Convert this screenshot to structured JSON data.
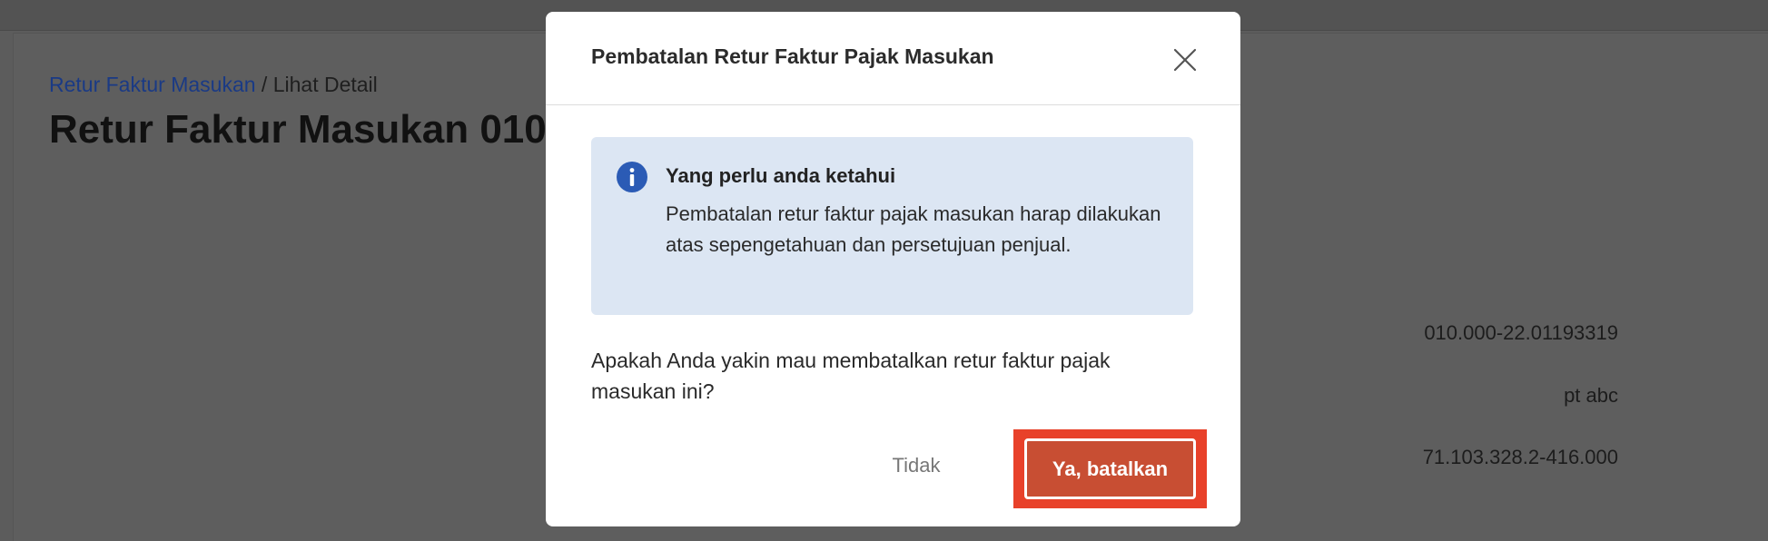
{
  "background": {
    "breadcrumb": {
      "link": "Retur Faktur Masukan",
      "separator": " / ",
      "current": "Lihat Detail"
    },
    "page_title": "Retur Faktur Masukan 010.0",
    "values": [
      "010.000-22.01193319",
      "pt abc",
      "71.103.328.2-416.000"
    ]
  },
  "modal": {
    "title": "Pembatalan Retur Faktur Pajak Masukan",
    "close_icon": "close-icon",
    "info": {
      "icon": "info-icon",
      "heading": "Yang perlu anda ketahui",
      "body": "Pembatalan retur faktur pajak masukan harap dilakukan atas sepengetahuan dan persetujuan penjual."
    },
    "question": "Apakah Anda yakin mau membatalkan retur faktur pajak masukan ini?",
    "cancel_label": "Tidak",
    "confirm_label": "Ya, batalkan"
  },
  "colors": {
    "overlay": "#5c5c5c",
    "info_background": "#dce6f3",
    "info_icon": "#2b5bb5",
    "confirm_button": "#c84e33",
    "highlight_frame": "#e8412a"
  }
}
